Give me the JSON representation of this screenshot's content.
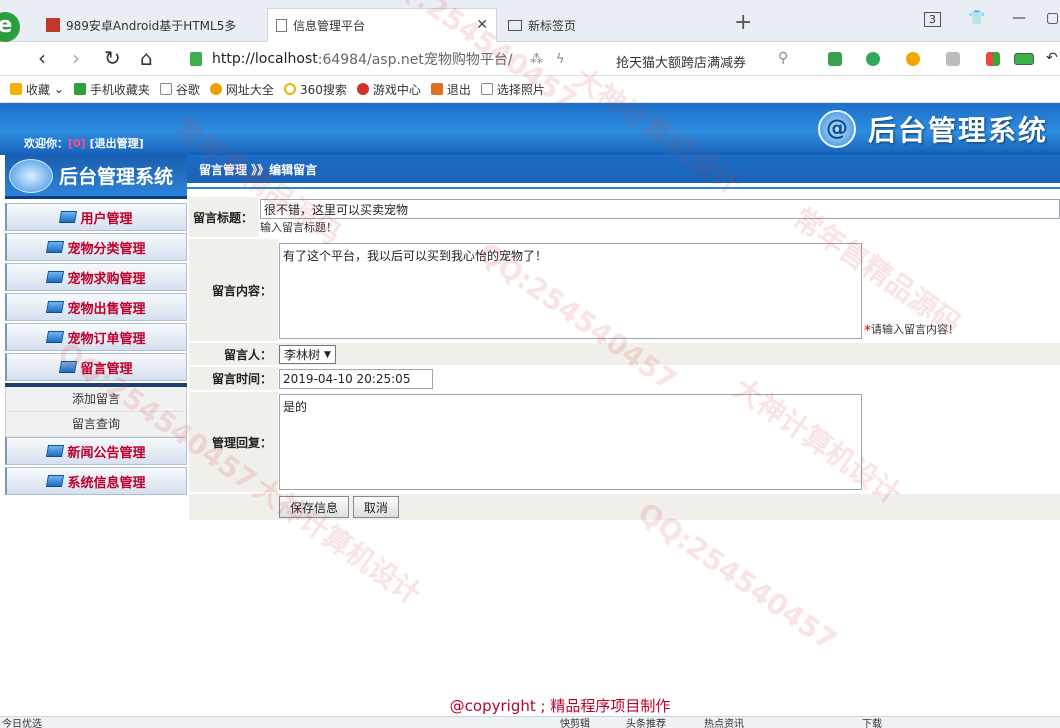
{
  "browser": {
    "tabs": [
      {
        "label": "989安卓Android基于HTML5多"
      },
      {
        "label": "信息管理平台"
      },
      {
        "label": "新标签页"
      }
    ],
    "tab_count": "3",
    "url_host": "http://localhost",
    "url_rest": ":64984/asp.net宠物购物平台/",
    "promo": "抢天猫大额跨店满减券",
    "favorites": [
      {
        "label": "收藏",
        "color": "#f0b400"
      },
      {
        "label": "手机收藏夹",
        "color": "#2e9e3f"
      },
      {
        "label": "谷歌",
        "color": "#777777"
      },
      {
        "label": "网址大全",
        "color": "#f0a000"
      },
      {
        "label": "360搜索",
        "color": "#f0b400"
      },
      {
        "label": "游戏中心",
        "color": "#d0332a"
      },
      {
        "label": "退出",
        "color": "#e07020"
      },
      {
        "label": "选择照片",
        "color": "#777777"
      }
    ]
  },
  "header": {
    "welcome_prefix": "欢迎你：",
    "username": "[0]",
    "logout": "[退出管理]",
    "system_title": "后台管理系统"
  },
  "sidebar": {
    "title": "后台管理系统",
    "menu_top": [
      {
        "label": "用户管理"
      },
      {
        "label": "宠物分类管理"
      },
      {
        "label": "宠物求购管理"
      },
      {
        "label": "宠物出售管理"
      },
      {
        "label": "宠物订单管理"
      },
      {
        "label": "留言管理"
      }
    ],
    "submenu": [
      {
        "label": "添加留言"
      },
      {
        "label": "留言查询"
      }
    ],
    "menu_bottom": [
      {
        "label": "新闻公告管理"
      },
      {
        "label": "系统信息管理"
      }
    ]
  },
  "breadcrumb": "留言管理 》》编辑留言",
  "form": {
    "title_label": "留言标题：",
    "title_value": "很不错，这里可以买卖宠物",
    "title_hint": "输入留言标题！",
    "content_label": "留言内容：",
    "content_value": "有了这个平台，我以后可以买到我心怡的宠物了！",
    "content_hint": "请输入留言内容！",
    "author_label": "留言人：",
    "author_value": "李林树",
    "time_label": "留言时间：",
    "time_value": "2019-04-10 20:25:05",
    "reply_label": "管理回复：",
    "reply_value": "是的",
    "save_label": "保存信息",
    "cancel_label": "取消"
  },
  "copyright": "@copyright ; 精品程序项目制作",
  "statusbar": {
    "left": "今日优选",
    "items": [
      "快剪辑",
      "头条推荐",
      "热点资讯",
      "下载"
    ]
  },
  "watermarks": [
    "QQ:254540457",
    "大神计算机设计",
    "常年售精品源码"
  ]
}
